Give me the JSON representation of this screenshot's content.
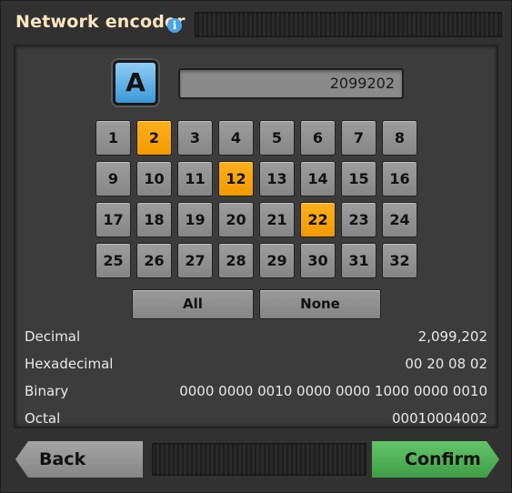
{
  "window": {
    "title": "Network encoder",
    "info_icon": "i"
  },
  "signal": {
    "label": "A",
    "value": "2099202"
  },
  "bits": [
    "1",
    "2",
    "3",
    "4",
    "5",
    "6",
    "7",
    "8",
    "9",
    "10",
    "11",
    "12",
    "13",
    "14",
    "15",
    "16",
    "17",
    "18",
    "19",
    "20",
    "21",
    "22",
    "23",
    "24",
    "25",
    "26",
    "27",
    "28",
    "29",
    "30",
    "31",
    "32"
  ],
  "active_bits": [
    2,
    12,
    22
  ],
  "colors": {
    "active": "#f5a000",
    "inactive": "#909090",
    "confirm": "#4caf50",
    "title": "#ffe6c0"
  },
  "buttons": {
    "all": "All",
    "none": "None"
  },
  "readouts": {
    "decimal_label": "Decimal",
    "decimal_value": "2,099,202",
    "hex_label": "Hexadecimal",
    "hex_value": "00 20 08 02",
    "binary_label": "Binary",
    "binary_value": "0000 0000 0010 0000 0000 1000 0000 0010",
    "octal_label": "Octal",
    "octal_value": "00010004002"
  },
  "footer": {
    "back": "Back",
    "confirm": "Confirm"
  }
}
